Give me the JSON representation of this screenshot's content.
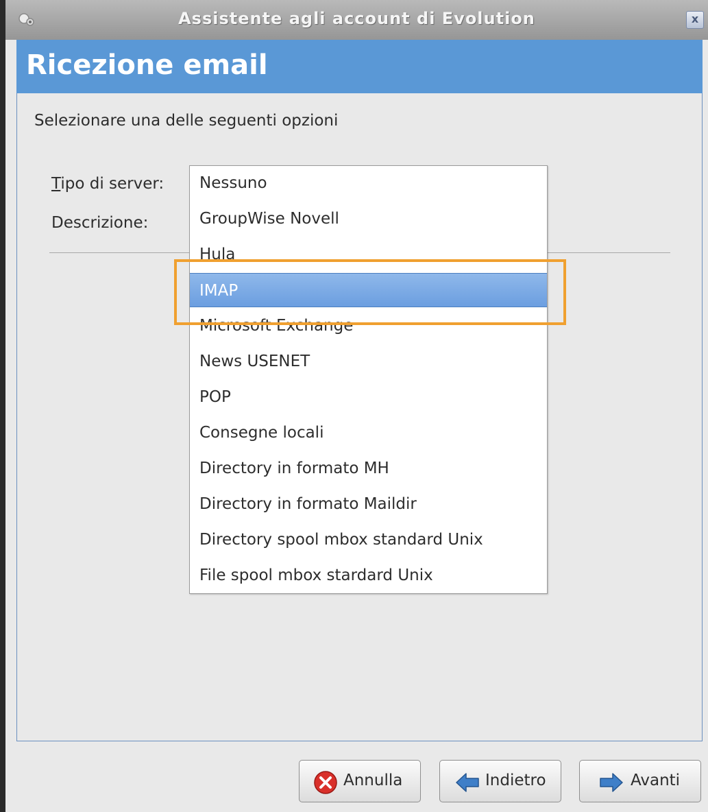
{
  "window": {
    "title": "Assistente agli account di Evolution",
    "close_glyph": "x",
    "app_icon": "evolution-icon"
  },
  "header": {
    "title": "Ricezione email"
  },
  "content": {
    "instruction": "Selezionare una delle seguenti opzioni",
    "server_type_label": "Tipo di server:",
    "description_label": "Descrizione:"
  },
  "server_types": {
    "selected": "IMAP",
    "options": [
      "Nessuno",
      "GroupWise Novell",
      "Hula",
      "IMAP",
      "Microsoft Exchange",
      "News USENET",
      "POP",
      "Consegne locali",
      "Directory in formato MH",
      "Directory in formato Maildir",
      "Directory spool mbox standard Unix",
      "File spool mbox stardard Unix"
    ]
  },
  "buttons": {
    "cancel": "Annulla",
    "back": "Indietro",
    "forward": "Avanti"
  },
  "colors": {
    "header": "#5a98d6",
    "selection": "#6b9ee0",
    "highlight_box": "#f0a030",
    "cancel_icon": "#d9302a",
    "arrow_icon": "#3f7fc8"
  }
}
